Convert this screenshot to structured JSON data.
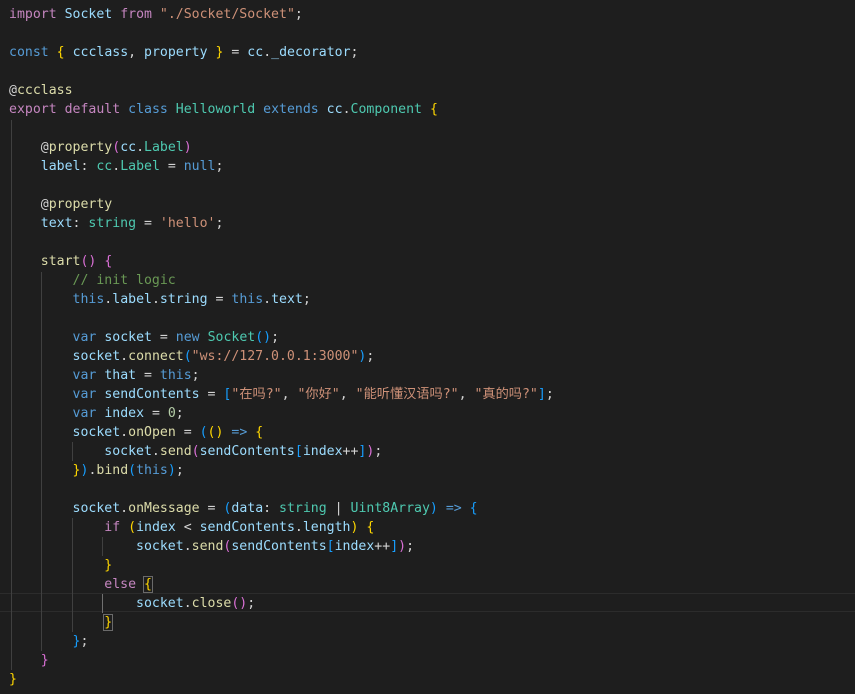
{
  "editor": {
    "theme_colors": {
      "background": "#1e1e1e",
      "keyword": "#569cd6",
      "control": "#c586c0",
      "class": "#4ec9b0",
      "function": "#dcdcaa",
      "variable": "#9cdcfe",
      "string": "#ce9178",
      "number": "#b5cea8",
      "comment": "#6a9955",
      "bracket1": "#ffd700",
      "bracket2": "#da70d6",
      "bracket3": "#179fff"
    },
    "lines": [
      [
        [
          "c",
          "import"
        ],
        [
          "p",
          " "
        ],
        [
          "v",
          "Socket"
        ],
        [
          "p",
          " "
        ],
        [
          "c",
          "from"
        ],
        [
          "p",
          " "
        ],
        [
          "s",
          "\"./Socket/Socket\""
        ],
        [
          "p",
          ";"
        ]
      ],
      [],
      [
        [
          "k",
          "const"
        ],
        [
          "p",
          " "
        ],
        [
          "b1",
          "{"
        ],
        [
          "p",
          " "
        ],
        [
          "v",
          "ccclass"
        ],
        [
          "p",
          ", "
        ],
        [
          "v",
          "property"
        ],
        [
          "p",
          " "
        ],
        [
          "b1",
          "}"
        ],
        [
          "p",
          " = "
        ],
        [
          "v",
          "cc"
        ],
        [
          "p",
          "."
        ],
        [
          "v",
          "_decorator"
        ],
        [
          "p",
          ";"
        ]
      ],
      [],
      [
        [
          "p",
          "@"
        ],
        [
          "f",
          "ccclass"
        ]
      ],
      [
        [
          "c",
          "export"
        ],
        [
          "p",
          " "
        ],
        [
          "c",
          "default"
        ],
        [
          "p",
          " "
        ],
        [
          "k",
          "class"
        ],
        [
          "p",
          " "
        ],
        [
          "t",
          "Helloworld"
        ],
        [
          "p",
          " "
        ],
        [
          "k",
          "extends"
        ],
        [
          "p",
          " "
        ],
        [
          "v",
          "cc"
        ],
        [
          "p",
          "."
        ],
        [
          "t",
          "Component"
        ],
        [
          "p",
          " "
        ],
        [
          "b1",
          "{"
        ]
      ],
      [],
      [
        [
          "p",
          "    @"
        ],
        [
          "f",
          "property"
        ],
        [
          "b2",
          "("
        ],
        [
          "v",
          "cc"
        ],
        [
          "p",
          "."
        ],
        [
          "t",
          "Label"
        ],
        [
          "b2",
          ")"
        ]
      ],
      [
        [
          "p",
          "    "
        ],
        [
          "v",
          "label"
        ],
        [
          "p",
          ": "
        ],
        [
          "t",
          "cc"
        ],
        [
          "p",
          "."
        ],
        [
          "t",
          "Label"
        ],
        [
          "p",
          " = "
        ],
        [
          "k",
          "null"
        ],
        [
          "p",
          ";"
        ]
      ],
      [],
      [
        [
          "p",
          "    @"
        ],
        [
          "f",
          "property"
        ]
      ],
      [
        [
          "p",
          "    "
        ],
        [
          "v",
          "text"
        ],
        [
          "p",
          ": "
        ],
        [
          "t",
          "string"
        ],
        [
          "p",
          " = "
        ],
        [
          "s",
          "'hello'"
        ],
        [
          "p",
          ";"
        ]
      ],
      [],
      [
        [
          "p",
          "    "
        ],
        [
          "f",
          "start"
        ],
        [
          "b2",
          "()"
        ],
        [
          "p",
          " "
        ],
        [
          "b2",
          "{"
        ]
      ],
      [
        [
          "p",
          "        "
        ],
        [
          "m",
          "// init logic"
        ]
      ],
      [
        [
          "p",
          "        "
        ],
        [
          "k",
          "this"
        ],
        [
          "p",
          "."
        ],
        [
          "v",
          "label"
        ],
        [
          "p",
          "."
        ],
        [
          "v",
          "string"
        ],
        [
          "p",
          " = "
        ],
        [
          "k",
          "this"
        ],
        [
          "p",
          "."
        ],
        [
          "v",
          "text"
        ],
        [
          "p",
          ";"
        ]
      ],
      [],
      [
        [
          "p",
          "        "
        ],
        [
          "k",
          "var"
        ],
        [
          "p",
          " "
        ],
        [
          "v",
          "socket"
        ],
        [
          "p",
          " = "
        ],
        [
          "k",
          "new"
        ],
        [
          "p",
          " "
        ],
        [
          "t",
          "Socket"
        ],
        [
          "b3",
          "()"
        ],
        [
          "p",
          ";"
        ]
      ],
      [
        [
          "p",
          "        "
        ],
        [
          "v",
          "socket"
        ],
        [
          "p",
          "."
        ],
        [
          "f",
          "connect"
        ],
        [
          "b3",
          "("
        ],
        [
          "s",
          "\"ws://127.0.0.1:3000\""
        ],
        [
          "b3",
          ")"
        ],
        [
          "p",
          ";"
        ]
      ],
      [
        [
          "p",
          "        "
        ],
        [
          "k",
          "var"
        ],
        [
          "p",
          " "
        ],
        [
          "v",
          "that"
        ],
        [
          "p",
          " = "
        ],
        [
          "k",
          "this"
        ],
        [
          "p",
          ";"
        ]
      ],
      [
        [
          "p",
          "        "
        ],
        [
          "k",
          "var"
        ],
        [
          "p",
          " "
        ],
        [
          "v",
          "sendContents"
        ],
        [
          "p",
          " = "
        ],
        [
          "b3",
          "["
        ],
        [
          "s",
          "\"在吗?\""
        ],
        [
          "p",
          ", "
        ],
        [
          "s",
          "\"你好\""
        ],
        [
          "p",
          ", "
        ],
        [
          "s",
          "\"能听懂汉语吗?\""
        ],
        [
          "p",
          ", "
        ],
        [
          "s",
          "\"真的吗?\""
        ],
        [
          "b3",
          "]"
        ],
        [
          "p",
          ";"
        ]
      ],
      [
        [
          "p",
          "        "
        ],
        [
          "k",
          "var"
        ],
        [
          "p",
          " "
        ],
        [
          "v",
          "index"
        ],
        [
          "p",
          " = "
        ],
        [
          "n",
          "0"
        ],
        [
          "p",
          ";"
        ]
      ],
      [
        [
          "p",
          "        "
        ],
        [
          "v",
          "socket"
        ],
        [
          "p",
          "."
        ],
        [
          "f",
          "onOpen"
        ],
        [
          "p",
          " = "
        ],
        [
          "b3",
          "("
        ],
        [
          "b1",
          "()"
        ],
        [
          "p",
          " "
        ],
        [
          "k",
          "=>"
        ],
        [
          "p",
          " "
        ],
        [
          "b1",
          "{"
        ]
      ],
      [
        [
          "p",
          "            "
        ],
        [
          "v",
          "socket"
        ],
        [
          "p",
          "."
        ],
        [
          "f",
          "send"
        ],
        [
          "b2",
          "("
        ],
        [
          "v",
          "sendContents"
        ],
        [
          "b3",
          "["
        ],
        [
          "v",
          "index"
        ],
        [
          "p",
          "++"
        ],
        [
          "b3",
          "]"
        ],
        [
          "b2",
          ")"
        ],
        [
          "p",
          ";"
        ]
      ],
      [
        [
          "p",
          "        "
        ],
        [
          "b1",
          "}"
        ],
        [
          "b3",
          ")"
        ],
        [
          "p",
          "."
        ],
        [
          "f",
          "bind"
        ],
        [
          "b3",
          "("
        ],
        [
          "k",
          "this"
        ],
        [
          "b3",
          ")"
        ],
        [
          "p",
          ";"
        ]
      ],
      [],
      [
        [
          "p",
          "        "
        ],
        [
          "v",
          "socket"
        ],
        [
          "p",
          "."
        ],
        [
          "f",
          "onMessage"
        ],
        [
          "p",
          " = "
        ],
        [
          "b3",
          "("
        ],
        [
          "v",
          "data"
        ],
        [
          "p",
          ": "
        ],
        [
          "t",
          "string"
        ],
        [
          "p",
          " | "
        ],
        [
          "t",
          "Uint8Array"
        ],
        [
          "b3",
          ")"
        ],
        [
          "p",
          " "
        ],
        [
          "k",
          "=>"
        ],
        [
          "p",
          " "
        ],
        [
          "b3",
          "{"
        ]
      ],
      [
        [
          "p",
          "            "
        ],
        [
          "c",
          "if"
        ],
        [
          "p",
          " "
        ],
        [
          "b1",
          "("
        ],
        [
          "v",
          "index"
        ],
        [
          "p",
          " < "
        ],
        [
          "v",
          "sendContents"
        ],
        [
          "p",
          "."
        ],
        [
          "v",
          "length"
        ],
        [
          "b1",
          ")"
        ],
        [
          "p",
          " "
        ],
        [
          "b1",
          "{"
        ]
      ],
      [
        [
          "p",
          "                "
        ],
        [
          "v",
          "socket"
        ],
        [
          "p",
          "."
        ],
        [
          "f",
          "send"
        ],
        [
          "b2",
          "("
        ],
        [
          "v",
          "sendContents"
        ],
        [
          "b3",
          "["
        ],
        [
          "v",
          "index"
        ],
        [
          "p",
          "++"
        ],
        [
          "b3",
          "]"
        ],
        [
          "b2",
          ")"
        ],
        [
          "p",
          ";"
        ]
      ],
      [
        [
          "p",
          "            "
        ],
        [
          "b1",
          "}"
        ]
      ],
      [
        [
          "p",
          "            "
        ],
        [
          "c",
          "else"
        ],
        [
          "p",
          " "
        ],
        [
          "bm1",
          "{"
        ]
      ],
      [
        [
          "p",
          "                "
        ],
        [
          "v",
          "socket"
        ],
        [
          "p",
          "."
        ],
        [
          "f",
          "close"
        ],
        [
          "b2",
          "()"
        ],
        [
          "p",
          ";"
        ]
      ],
      [
        [
          "p",
          "            "
        ],
        [
          "bm1",
          "}"
        ]
      ],
      [
        [
          "p",
          "        "
        ],
        [
          "b3",
          "}"
        ],
        [
          "p",
          ";"
        ]
      ],
      [
        [
          "p",
          "    "
        ],
        [
          "b2",
          "}"
        ]
      ],
      [
        [
          "b1",
          "}"
        ]
      ]
    ]
  }
}
